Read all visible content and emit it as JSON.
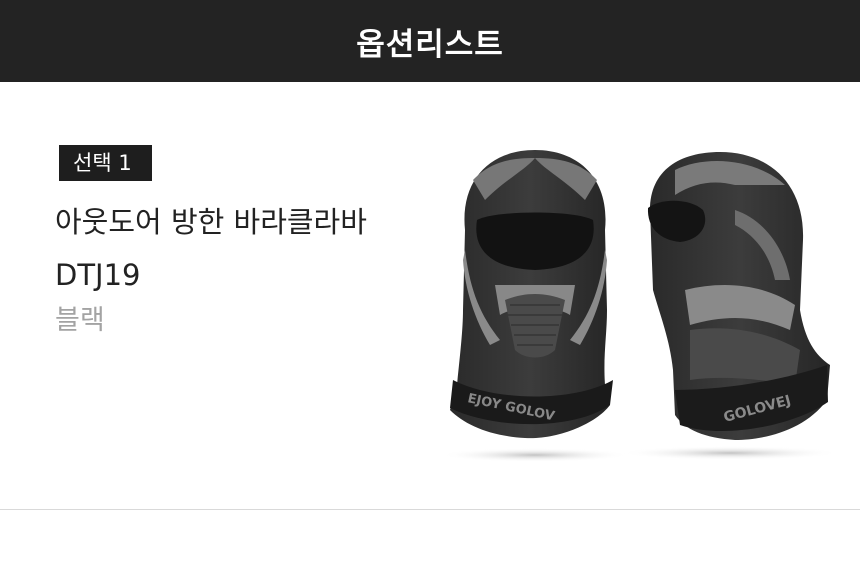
{
  "header": {
    "title": "옵션리스트"
  },
  "option": {
    "badge": "선택 1",
    "product_name": "아웃도어 방한 바라클라바 DTJ19",
    "color": "블랙",
    "image": {
      "front_brand_text": "EJOY  GOLOV",
      "side_brand_text": "GOLOVEJ"
    }
  }
}
